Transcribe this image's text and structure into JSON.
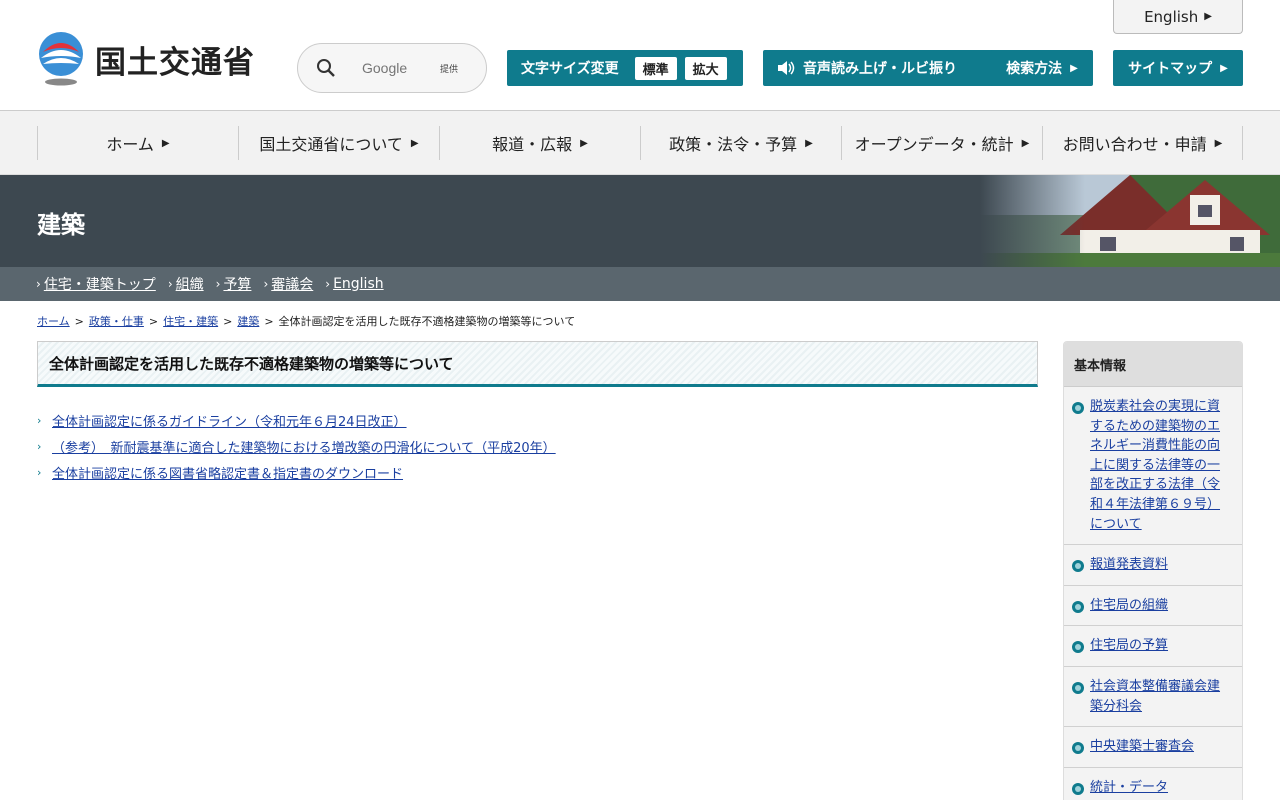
{
  "header": {
    "site_name": "国土交通省",
    "english_link": "English",
    "search": {
      "placeholder": "Google",
      "provider_label": "提供"
    },
    "font_size": {
      "label": "文字サイズ変更",
      "standard": "標準",
      "large": "拡大"
    },
    "voice_button": "音声読み上げ・ルビ振り",
    "search_method_button": "検索方法",
    "sitemap_button": "サイトマップ"
  },
  "global_nav": [
    {
      "label": "ホーム"
    },
    {
      "label": "国土交通省について"
    },
    {
      "label": "報道・広報"
    },
    {
      "label": "政策・法令・予算"
    },
    {
      "label": "オープンデータ・統計"
    },
    {
      "label": "お問い合わせ・申請"
    }
  ],
  "banner": {
    "title": "建築",
    "subnav": [
      "住宅・建築トップ",
      "組織",
      "予算",
      "審議会",
      "English"
    ]
  },
  "breadcrumb": {
    "items": [
      "ホーム",
      "政策・仕事",
      "住宅・建築",
      "建築"
    ],
    "current": "全体計画認定を活用した既存不適格建築物の増築等について"
  },
  "main": {
    "heading": "全体計画認定を活用した既存不適格建築物の増築等について",
    "links": [
      "全体計画認定に係るガイドライン（令和元年６月24日改正）",
      "（参考）　新耐震基準に適合した建築物における増改築の円滑化について（平成20年）",
      "全体計画認定に係る図書省略認定書＆指定書のダウンロード"
    ]
  },
  "sidebar": {
    "title": "基本情報",
    "items": [
      "脱炭素社会の実現に資するための建築物のエネルギー消費性能の向上に関する法律等の一部を改正する法律（令和４年法律第６９号）について",
      "報道発表資料",
      "住宅局の組織",
      "住宅局の予算",
      "社会資本整備審議会建築分科会",
      "中央建築士審査会",
      "統計・データ"
    ]
  },
  "colors": {
    "accent": "#0f7b8d",
    "banner": "#3d4850",
    "subnav": "#5a666e",
    "link": "#1a3fa0"
  }
}
